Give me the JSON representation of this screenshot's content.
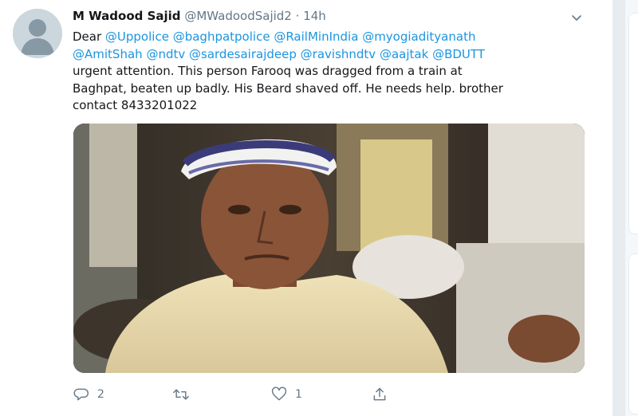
{
  "tweet": {
    "author_name": "M Wadood Sajid",
    "author_handle": "@MWadoodSajid2",
    "separator": "·",
    "time": "14h",
    "text": {
      "dear": "Dear ",
      "mentions_line1": [
        "@Uppolice",
        "@baghpatpolice",
        "@RailMinIndia",
        "@myogiadityanath"
      ],
      "mentions_line2": [
        "@AmitShah",
        "@ndtv",
        "@sardesairajdeep",
        "@ravishndtv",
        "@aajtak",
        "@BDUTT"
      ],
      "line3": "urgent attention. This person Farooq was dragged from a train at",
      "line4": "Baghpat, beaten up badly. His Beard shaved off. He needs help. brother",
      "line5": "contact 8433201022"
    },
    "actions": {
      "reply_icon": "reply-icon",
      "reply_count": "2",
      "retweet_icon": "retweet-icon",
      "retweet_count": "",
      "like_icon": "heart-icon",
      "like_count": "1",
      "share_icon": "share-icon"
    }
  },
  "colors": {
    "link": "#1b95e0",
    "text": "#14171a",
    "muted": "#657786",
    "background": "#e6ecf0"
  }
}
